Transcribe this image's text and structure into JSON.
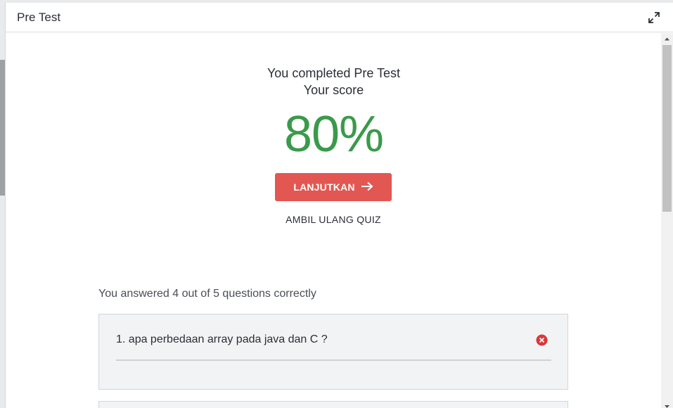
{
  "modal": {
    "title": "Pre Test",
    "expand_icon": "expand-arrows-icon"
  },
  "result": {
    "completed_text": "You completed Pre Test",
    "score_label": "Your score",
    "score_value": "80%",
    "score_color": "#3a9a4b"
  },
  "actions": {
    "continue_label": "LANJUTKAN",
    "continue_icon": "arrow-right-icon",
    "continue_color": "#e25752",
    "retake_label": "AMBIL ULANG QUIZ"
  },
  "summary": {
    "answered_text": "You answered 4 out of 5 questions correctly"
  },
  "questions": [
    {
      "text": "1. apa perbedaan array pada java dan C ?",
      "status_icon": "incorrect-x-icon",
      "status_color": "#d9373a"
    }
  ]
}
